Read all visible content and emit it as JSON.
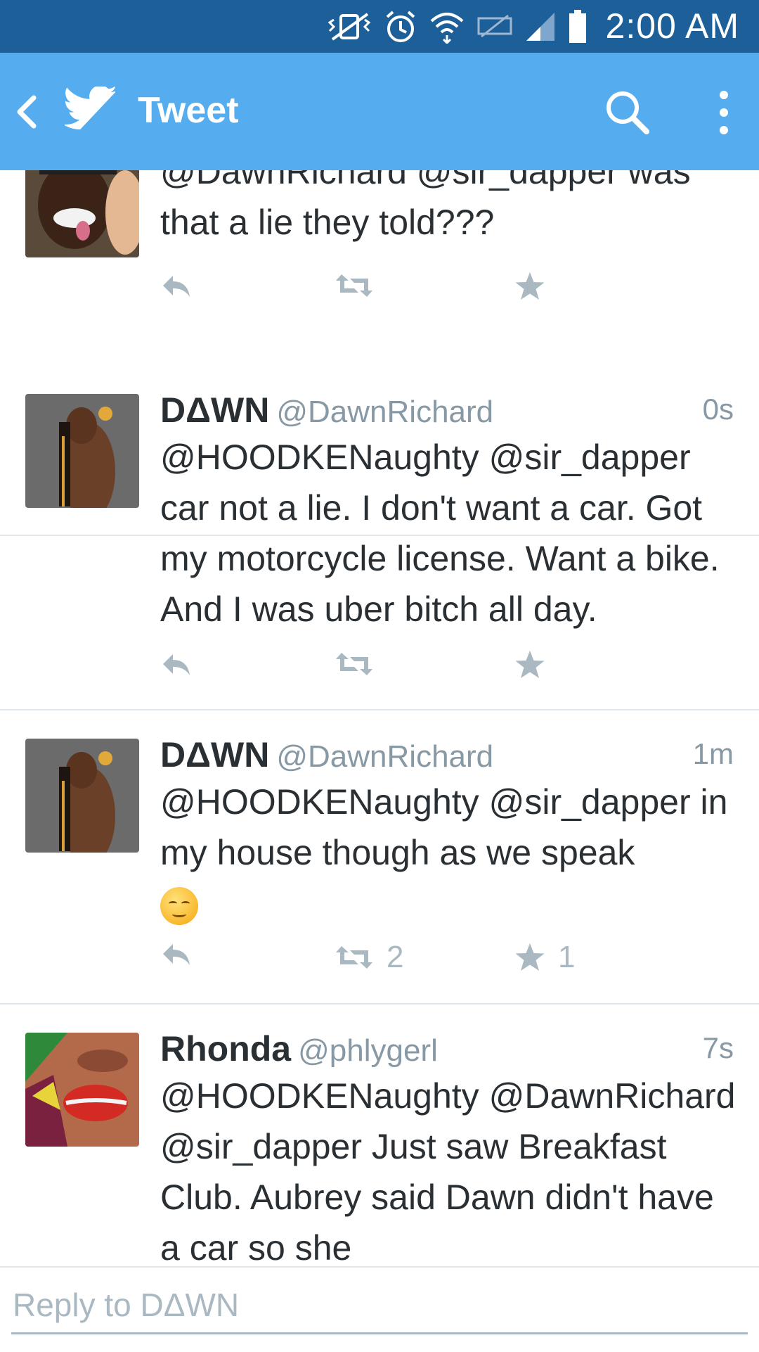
{
  "status_bar": {
    "time": "2:00 AM"
  },
  "app_bar": {
    "title": "Tweet"
  },
  "tweets": [
    {
      "display_name": "",
      "screen_name": "",
      "timestamp": "",
      "text": "@DawnRichard @sir_dapper was that a lie they told???",
      "retweets": "",
      "favorites": ""
    },
    {
      "display_name": "DΔWN",
      "screen_name": "@DawnRichard",
      "timestamp": "0s",
      "text": "@HOODKENaughty @sir_dapper car not a lie. I don't want a car. Got my motorcycle license. Want a bike. And I was uber bitch all day.",
      "retweets": "",
      "favorites": ""
    },
    {
      "display_name": "DΔWN",
      "screen_name": "@DawnRichard",
      "timestamp": "1m",
      "text": "@HOODKENaughty @sir_dapper in my house though as we speak",
      "retweets": "2",
      "favorites": "1"
    },
    {
      "display_name": "Rhonda",
      "screen_name": "@phlygerl",
      "timestamp": "7s",
      "text": "@HOODKENaughty @DawnRichard @sir_dapper Just saw Breakfast Club. Aubrey said Dawn didn't have a car so she",
      "retweets": "",
      "favorites": ""
    }
  ],
  "reply": {
    "placeholder": "Reply to DΔWN"
  },
  "colors": {
    "status_bar": "#1d5f99",
    "app_bar": "#55acee",
    "action_icon": "#aab8c2",
    "secondary_text": "#8899a6",
    "primary_text": "#292f33"
  }
}
